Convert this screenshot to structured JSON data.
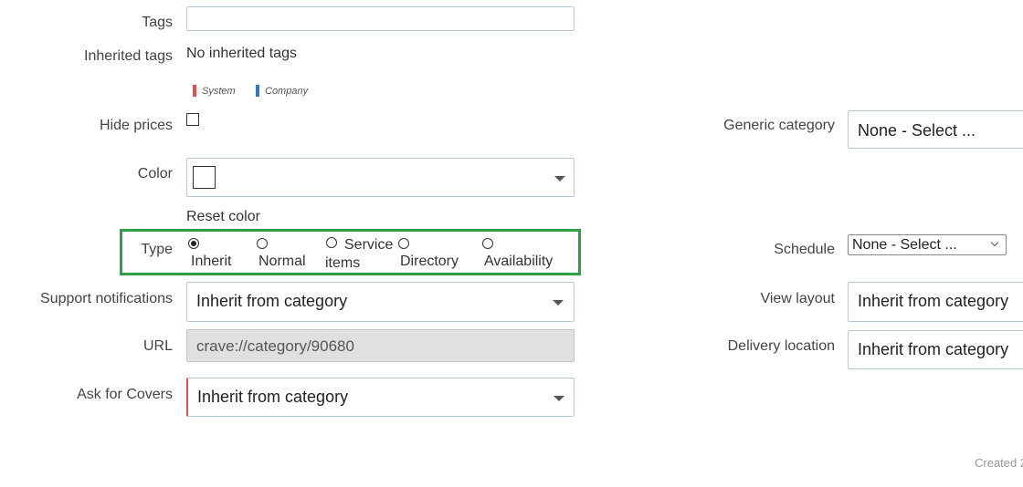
{
  "form": {
    "tags": {
      "label": "Tags",
      "value": ""
    },
    "inherited_tags": {
      "label": "Inherited tags",
      "value": "No inherited tags"
    },
    "legend": [
      {
        "name": "System",
        "color": "#d9534f"
      },
      {
        "name": "Company",
        "color": "#337ab7"
      }
    ],
    "hide_prices": {
      "label": "Hide prices",
      "checked": false
    },
    "color": {
      "label": "Color",
      "reset_label": "Reset color"
    },
    "type": {
      "label": "Type",
      "options": [
        {
          "label_line1": "",
          "label_line2": "Inherit",
          "selected": true
        },
        {
          "label_line1": "",
          "label_line2": "Normal",
          "selected": false
        },
        {
          "label_line1": "Service",
          "label_line2": "items",
          "selected": false
        },
        {
          "label_line1": "",
          "label_line2": "Directory",
          "selected": false
        },
        {
          "label_line1": "",
          "label_line2": "Availability",
          "selected": false
        }
      ],
      "highlight_color": "#2ea043"
    },
    "support_notifications": {
      "label": "Support notifications",
      "value": "Inherit from category"
    },
    "url": {
      "label": "URL",
      "value": "crave://category/90680"
    },
    "ask_for_covers": {
      "label": "Ask for Covers",
      "value": "Inherit from category",
      "accent": "#d9534f"
    }
  },
  "right": {
    "generic_category": {
      "label": "Generic category",
      "value": "None - Select ..."
    },
    "schedule": {
      "label": "Schedule",
      "value": "None - Select ..."
    },
    "view_layout": {
      "label": "View layout",
      "value": "Inherit from category"
    },
    "delivery_location": {
      "label": "Delivery location",
      "value": "Inherit from category"
    }
  },
  "footer": {
    "created_text": "Created 2"
  }
}
